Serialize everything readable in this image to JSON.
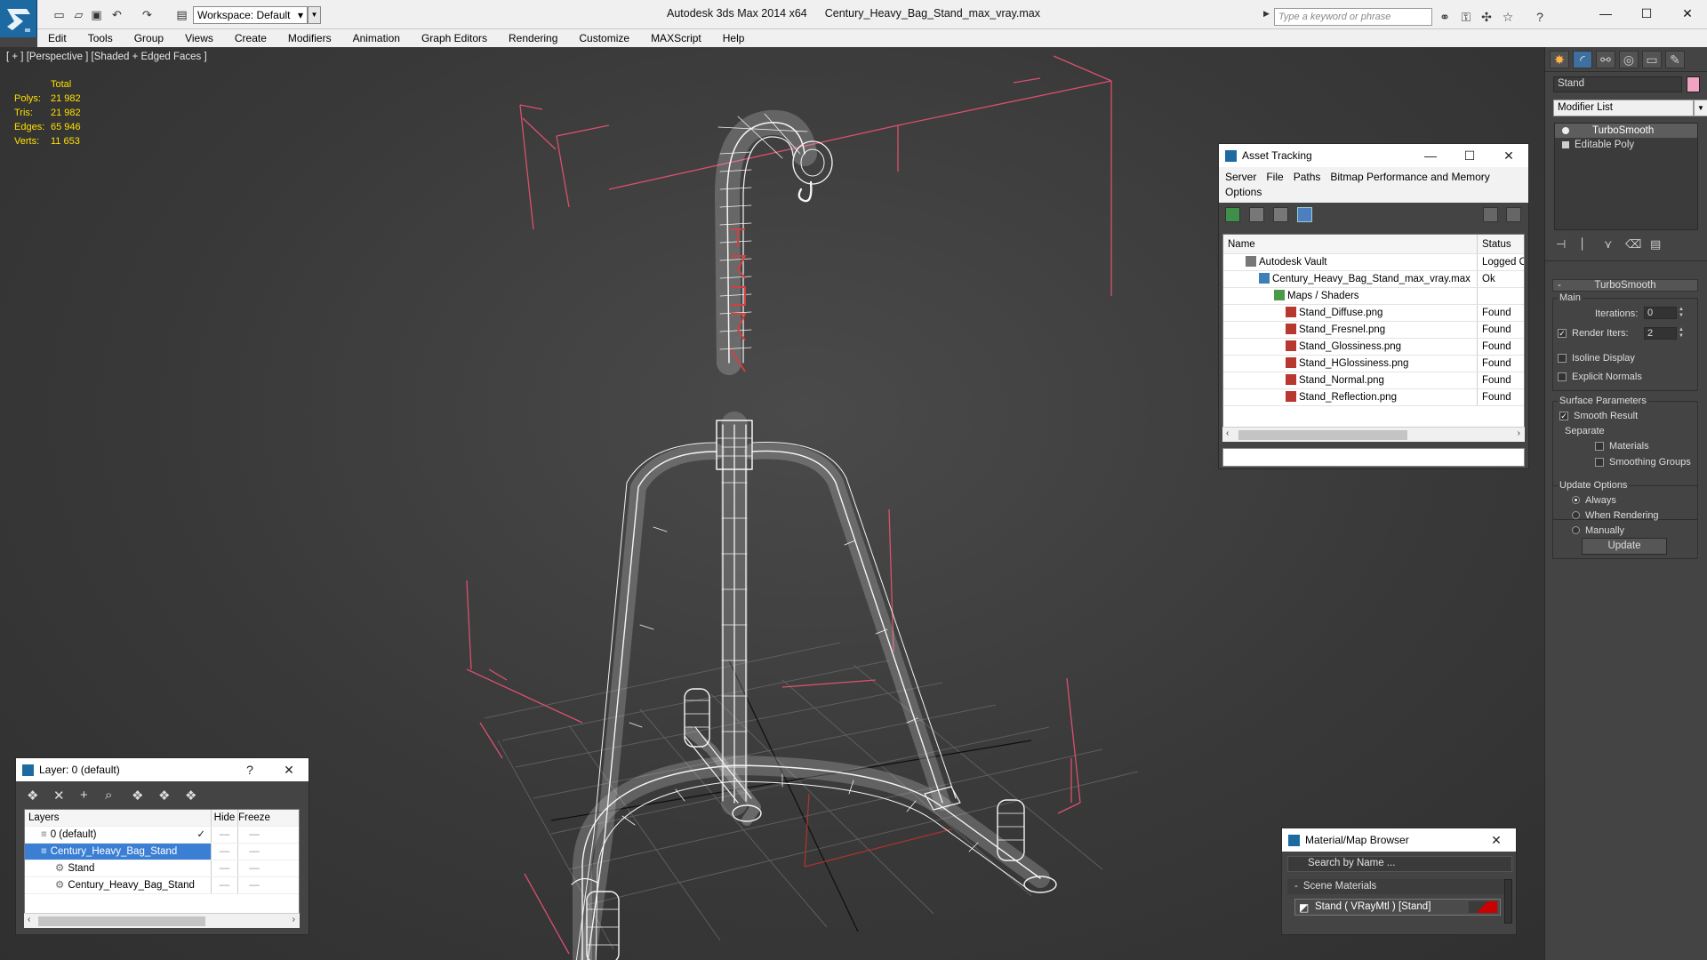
{
  "app": {
    "title": "Autodesk 3ds Max  2014 x64",
    "file": "Century_Heavy_Bag_Stand_max_vray.max",
    "workspace": "Workspace: Default",
    "search_placeholder": "Type a keyword or phrase"
  },
  "menu": [
    "Edit",
    "Tools",
    "Group",
    "Views",
    "Create",
    "Modifiers",
    "Animation",
    "Graph Editors",
    "Rendering",
    "Customize",
    "MAXScript",
    "Help"
  ],
  "viewport": {
    "label": "[ + ] [Perspective ] [Shaded + Edged Faces ]",
    "stats": {
      "header": "Total",
      "rows": [
        {
          "k": "Polys:",
          "v": "21 982"
        },
        {
          "k": "Tris:",
          "v": "21 982"
        },
        {
          "k": "Edges:",
          "v": "65 946"
        },
        {
          "k": "Verts:",
          "v": "11 653"
        }
      ]
    }
  },
  "asset_tracking": {
    "title": "Asset Tracking",
    "menu": [
      "Server",
      "File",
      "Paths",
      "Bitmap Performance and Memory"
    ],
    "menu2": "Options",
    "columns": {
      "name": "Name",
      "status": "Status"
    },
    "rows": [
      {
        "name": "Autodesk Vault",
        "status": "Logged Out"
      },
      {
        "name": "Century_Heavy_Bag_Stand_max_vray.max",
        "status": "Ok"
      },
      {
        "name": "Maps / Shaders",
        "status": ""
      },
      {
        "name": "Stand_Diffuse.png",
        "status": "Found"
      },
      {
        "name": "Stand_Fresnel.png",
        "status": "Found"
      },
      {
        "name": "Stand_Glossiness.png",
        "status": "Found"
      },
      {
        "name": "Stand_HGlossiness.png",
        "status": "Found"
      },
      {
        "name": "Stand_Normal.png",
        "status": "Found"
      },
      {
        "name": "Stand_Reflection.png",
        "status": "Found"
      }
    ]
  },
  "layer": {
    "title": "Layer: 0 (default)",
    "help": "?",
    "columns": {
      "layers": "Layers",
      "hide": "Hide",
      "freeze": "Freeze"
    },
    "rows": [
      {
        "name": "0 (default)",
        "hide": "—",
        "freeze": "—"
      },
      {
        "name": "Century_Heavy_Bag_Stand",
        "hide": "—",
        "freeze": "—"
      },
      {
        "name": "Stand",
        "hide": "—",
        "freeze": "—"
      },
      {
        "name": "Century_Heavy_Bag_Stand",
        "hide": "—",
        "freeze": "—"
      }
    ]
  },
  "material_browser": {
    "title": "Material/Map Browser",
    "search_placeholder": "Search by Name ...",
    "group": "Scene Materials",
    "item": "Stand  ( VRayMtl )  [Stand]"
  },
  "command_panel": {
    "object_name": "Stand",
    "modifier_list": "Modifier List",
    "stack": [
      "TurboSmooth",
      "Editable Poly"
    ],
    "rollout": "TurboSmooth",
    "main": "Main",
    "iterations_label": "Iterations:",
    "iterations": "0",
    "render_iters_label": "Render Iters:",
    "render_iters": "2",
    "isoline": "Isoline Display",
    "explicit_normals": "Explicit Normals",
    "surface_params": "Surface Parameters",
    "smooth_result": "Smooth Result",
    "separate": "Separate",
    "materials": "Materials",
    "smoothing_groups": "Smoothing Groups",
    "update_options": "Update Options",
    "always": "Always",
    "when_rendering": "When Rendering",
    "manually": "Manually",
    "update": "Update"
  },
  "colors": {
    "accent": "#3a7fd4",
    "wire": "#ffffff",
    "bbox": "#d9506e",
    "stats": "#ffe000"
  }
}
